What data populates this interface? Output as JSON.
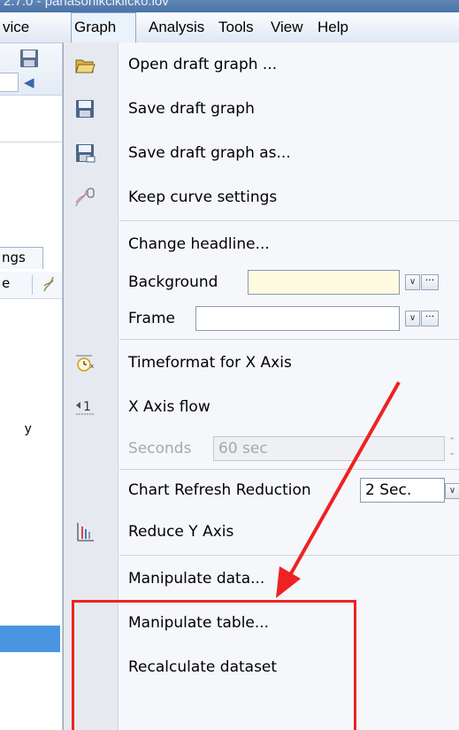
{
  "window": {
    "title": "2.7.0 - panasonikciklicko.lov"
  },
  "menubar": {
    "items": [
      {
        "label": "vice"
      },
      {
        "label": "Graph"
      },
      {
        "label": "Analysis"
      },
      {
        "label": "Tools"
      },
      {
        "label": "View"
      },
      {
        "label": "Help"
      }
    ]
  },
  "background_panel": {
    "tab_label": "ngs",
    "row_label": "e",
    "side_text": "y"
  },
  "graph_menu": {
    "open_draft": "Open draft graph ...",
    "save_draft": "Save draft graph",
    "save_draft_as": "Save draft graph as...",
    "keep_curve": "Keep curve settings",
    "change_headline": "Change headline...",
    "background": {
      "label": "Background",
      "color": "#fffbe0"
    },
    "frame": {
      "label": "Frame"
    },
    "timeformat": "Timeformat for X Axis",
    "x_axis_flow": "X Axis flow",
    "seconds": {
      "label": "Seconds",
      "value": "60 sec"
    },
    "chart_refresh": {
      "label": "Chart Refresh Reduction",
      "value": "2 Sec."
    },
    "reduce_y": "Reduce Y Axis",
    "manipulate_data": "Manipulate data...",
    "manipulate_table": "Manipulate table...",
    "recalculate": "Recalculate dataset"
  },
  "annotation": {
    "color": "#ee2222"
  }
}
